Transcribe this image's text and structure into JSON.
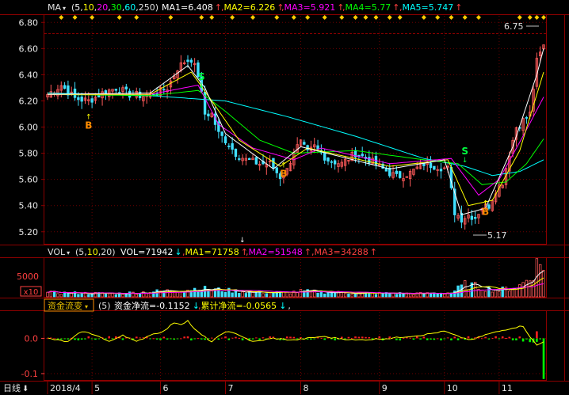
{
  "colors": {
    "background": "#000000",
    "frame": "#8b0000",
    "grid": "#6b0000",
    "axis_text": "#e8e8e8",
    "up_candle": "#ff5a5a",
    "down_candle": "#40e0ff",
    "ma1": "#ffffff",
    "ma2": "#ffff00",
    "ma3": "#ff00ff",
    "ma4": "#00ff00",
    "ma5": "#00ffff",
    "signal_diamond": "#ffcc00",
    "buy_marker": "#ff8c00",
    "sell_marker": "#00ff40",
    "flow_line": "#ffff00",
    "flow_pos": "#ff2020",
    "flow_neg": "#00ff00"
  },
  "price_panel": {
    "indicator_label": "MA",
    "params": "(5,10,20,30,60,250)",
    "ma_values": [
      {
        "name": "MA1",
        "text": "MA1=6.408",
        "arrow": "↑"
      },
      {
        "name": "MA2",
        "text": "MA2=6.226",
        "arrow": "↑"
      },
      {
        "name": "MA3",
        "text": "MA3=5.921",
        "arrow": "↑"
      },
      {
        "name": "MA4",
        "text": "MA4=5.77",
        "arrow": "↑"
      },
      {
        "name": "MA5",
        "text": "MA5=5.747",
        "arrow": "↑"
      }
    ],
    "high_label": "6.75",
    "low_label": "5.17",
    "signals": [
      {
        "label": "B",
        "x": 12,
        "y": 6.05
      },
      {
        "label": "S",
        "x": 45,
        "y": 6.36
      },
      {
        "label": "B",
        "x": 69,
        "y": 5.68
      },
      {
        "label": "S",
        "x": 122,
        "y": 5.79
      },
      {
        "label": "B",
        "x": 128,
        "y": 5.39
      }
    ]
  },
  "volume_panel": {
    "indicator_label": "VOL",
    "params_prefix": "(5,",
    "params_mid": "10",
    "params_suffix": ",20)",
    "vol_text": "VOL=71942",
    "vol_arrow": "↓",
    "ma_values": [
      {
        "name": "MA1",
        "text": "MA1=71758",
        "arrow": "↑"
      },
      {
        "name": "MA2",
        "text": "MA2=51548",
        "arrow": "↑"
      },
      {
        "name": "MA3",
        "text": "MA3=34288",
        "arrow": "↑"
      }
    ],
    "tick_label": "5000",
    "unit_label": "x10"
  },
  "flow_panel": {
    "indicator_label": "资金流变",
    "param": "(5)",
    "net_text": "资金净流=-0.1152",
    "net_arrow": "↓",
    "cum_text": "累计净流=-0.0565",
    "cum_arrow": "↓",
    "trailing": ","
  },
  "x_axis": {
    "period_label": "日线",
    "labels": [
      "2018/4",
      "5",
      "6",
      "7",
      "8",
      "9",
      "10",
      "11"
    ]
  },
  "chart_data": [
    {
      "type": "candlestick",
      "title": "",
      "ylim": [
        5.12,
        6.85
      ],
      "yticks": [
        5.2,
        5.4,
        5.6,
        5.8,
        6.0,
        6.2,
        6.4,
        6.6,
        6.8
      ],
      "x_index_range": [
        0,
        145
      ],
      "month_starts": [
        {
          "label": "2018/4",
          "index": 0
        },
        {
          "label": "5",
          "index": 13
        },
        {
          "label": "6",
          "index": 33
        },
        {
          "label": "7",
          "index": 52
        },
        {
          "label": "8",
          "index": 74
        },
        {
          "label": "9",
          "index": 97
        },
        {
          "label": "10",
          "index": 116
        },
        {
          "label": "11",
          "index": 132
        }
      ],
      "close_keypoints": [
        [
          0,
          6.25
        ],
        [
          4,
          6.32
        ],
        [
          8,
          6.22
        ],
        [
          12,
          6.2
        ],
        [
          16,
          6.26
        ],
        [
          20,
          6.3
        ],
        [
          24,
          6.25
        ],
        [
          28,
          6.24
        ],
        [
          32,
          6.26
        ],
        [
          35,
          6.3
        ],
        [
          38,
          6.45
        ],
        [
          40,
          6.5
        ],
        [
          42,
          6.52
        ],
        [
          44,
          6.4
        ],
        [
          46,
          6.1
        ],
        [
          48,
          6.1
        ],
        [
          50,
          5.95
        ],
        [
          52,
          5.9
        ],
        [
          55,
          5.8
        ],
        [
          58,
          5.75
        ],
        [
          62,
          5.72
        ],
        [
          65,
          5.72
        ],
        [
          68,
          5.62
        ],
        [
          70,
          5.67
        ],
        [
          72,
          5.82
        ],
        [
          74,
          5.88
        ],
        [
          76,
          5.8
        ],
        [
          78,
          5.85
        ],
        [
          82,
          5.75
        ],
        [
          86,
          5.72
        ],
        [
          90,
          5.8
        ],
        [
          94,
          5.75
        ],
        [
          98,
          5.68
        ],
        [
          102,
          5.62
        ],
        [
          106,
          5.65
        ],
        [
          110,
          5.72
        ],
        [
          114,
          5.7
        ],
        [
          117,
          5.68
        ],
        [
          119,
          5.35
        ],
        [
          121,
          5.3
        ],
        [
          123,
          5.33
        ],
        [
          125,
          5.31
        ],
        [
          127,
          5.39
        ],
        [
          129,
          5.4
        ],
        [
          131,
          5.52
        ],
        [
          133,
          5.58
        ],
        [
          135,
          5.8
        ],
        [
          137,
          6.0
        ],
        [
          139,
          6.05
        ],
        [
          141,
          6.1
        ],
        [
          143,
          6.5
        ],
        [
          145,
          6.62
        ]
      ],
      "ma_keypoints": {
        "MA5": [
          [
            0,
            6.26
          ],
          [
            30,
            6.24
          ],
          [
            52,
            6.2
          ],
          [
            70,
            6.08
          ],
          [
            90,
            5.93
          ],
          [
            110,
            5.76
          ],
          [
            122,
            5.7
          ],
          [
            130,
            5.63
          ],
          [
            138,
            5.66
          ],
          [
            145,
            5.75
          ]
        ],
        "MA4": [
          [
            0,
            6.25
          ],
          [
            30,
            6.24
          ],
          [
            44,
            6.28
          ],
          [
            52,
            6.12
          ],
          [
            62,
            5.9
          ],
          [
            72,
            5.8
          ],
          [
            90,
            5.82
          ],
          [
            110,
            5.75
          ],
          [
            120,
            5.72
          ],
          [
            127,
            5.56
          ],
          [
            134,
            5.58
          ],
          [
            140,
            5.72
          ],
          [
            145,
            5.91
          ]
        ],
        "MA3": [
          [
            0,
            6.25
          ],
          [
            30,
            6.25
          ],
          [
            44,
            6.32
          ],
          [
            50,
            6.02
          ],
          [
            60,
            5.84
          ],
          [
            72,
            5.75
          ],
          [
            80,
            5.84
          ],
          [
            100,
            5.72
          ],
          [
            118,
            5.76
          ],
          [
            126,
            5.48
          ],
          [
            132,
            5.6
          ],
          [
            140,
            5.98
          ],
          [
            145,
            6.23
          ]
        ],
        "MA2": [
          [
            0,
            6.25
          ],
          [
            30,
            6.25
          ],
          [
            42,
            6.42
          ],
          [
            48,
            6.2
          ],
          [
            56,
            5.9
          ],
          [
            68,
            5.7
          ],
          [
            76,
            5.84
          ],
          [
            100,
            5.7
          ],
          [
            117,
            5.75
          ],
          [
            123,
            5.4
          ],
          [
            130,
            5.44
          ],
          [
            138,
            5.82
          ],
          [
            145,
            6.42
          ]
        ],
        "MA1": [
          [
            0,
            6.25
          ],
          [
            30,
            6.26
          ],
          [
            41,
            6.47
          ],
          [
            46,
            6.3
          ],
          [
            52,
            5.95
          ],
          [
            66,
            5.68
          ],
          [
            74,
            5.85
          ],
          [
            100,
            5.68
          ],
          [
            116,
            5.75
          ],
          [
            121,
            5.33
          ],
          [
            128,
            5.38
          ],
          [
            136,
            5.85
          ],
          [
            143,
            6.4
          ],
          [
            145,
            6.6
          ]
        ]
      }
    },
    {
      "type": "bar",
      "title": "VOL",
      "ylim": [
        0,
        8200
      ],
      "yticks": [
        5000
      ],
      "x_index_range": [
        0,
        145
      ],
      "volume_keypoints": [
        [
          0,
          900
        ],
        [
          20,
          700
        ],
        [
          38,
          1400
        ],
        [
          44,
          1800
        ],
        [
          50,
          1500
        ],
        [
          60,
          1000
        ],
        [
          70,
          900
        ],
        [
          74,
          1200
        ],
        [
          90,
          800
        ],
        [
          110,
          700
        ],
        [
          118,
          900
        ],
        [
          122,
          2600
        ],
        [
          126,
          2200
        ],
        [
          132,
          1400
        ],
        [
          138,
          2400
        ],
        [
          141,
          4200
        ],
        [
          143,
          6800
        ],
        [
          145,
          7200
        ]
      ]
    },
    {
      "type": "bar",
      "title": "资金流变",
      "ylim": [
        -0.118,
        0.075
      ],
      "yticks": [
        0.0,
        -0.1
      ],
      "ytick_labels": [
        "0.0",
        "-0.1"
      ],
      "x_index_range": [
        0,
        145
      ],
      "line_keypoints": [
        [
          0,
          0
        ],
        [
          6,
          -0.01
        ],
        [
          10,
          0.02
        ],
        [
          14,
          0.01
        ],
        [
          18,
          -0.01
        ],
        [
          22,
          0.01
        ],
        [
          26,
          -0.01
        ],
        [
          30,
          0.01
        ],
        [
          34,
          0.02
        ],
        [
          37,
          0.045
        ],
        [
          39,
          0.04
        ],
        [
          41,
          0.05
        ],
        [
          43,
          0.025
        ],
        [
          45,
          0.01
        ],
        [
          48,
          -0.01
        ],
        [
          52,
          0.02
        ],
        [
          56,
          0.01
        ],
        [
          60,
          -0.01
        ],
        [
          66,
          0.0
        ],
        [
          72,
          -0.005
        ],
        [
          80,
          0.005
        ],
        [
          90,
          -0.005
        ],
        [
          100,
          0.0
        ],
        [
          110,
          0.01
        ],
        [
          116,
          0.02
        ],
        [
          120,
          0.005
        ],
        [
          124,
          -0.005
        ],
        [
          128,
          0.01
        ],
        [
          132,
          0.02
        ],
        [
          136,
          0.03
        ],
        [
          139,
          0.035
        ],
        [
          141,
          0.005
        ],
        [
          143,
          -0.02
        ],
        [
          145,
          -0.01
        ]
      ],
      "final_bar": -0.1152
    }
  ]
}
